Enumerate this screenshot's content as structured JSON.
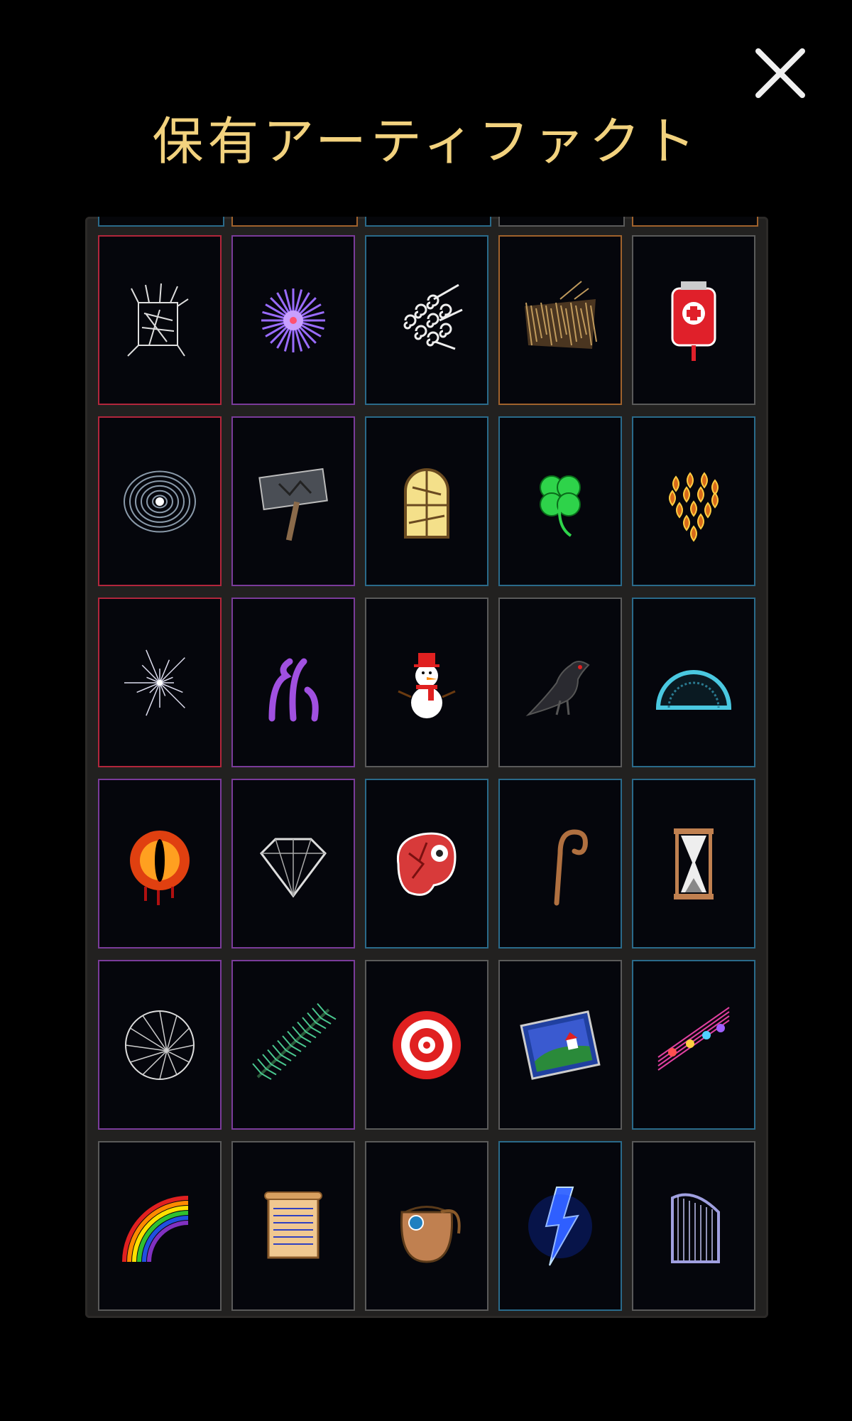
{
  "header": {
    "title": "保有アーティファクト",
    "close_icon": "close-icon"
  },
  "colors": {
    "title": "#f2d27e",
    "red": "#b2263c",
    "purple": "#7a3b9a",
    "blue": "#2a6a8a",
    "orange": "#a0622c",
    "gray": "#5a5a5a"
  },
  "top_peek_rarities": [
    "blue",
    "orange",
    "blue",
    "gray",
    "orange"
  ],
  "artifacts": [
    {
      "icon": "thorny-cage-icon",
      "rarity": "red"
    },
    {
      "icon": "purple-spiky-orb-icon",
      "rarity": "purple"
    },
    {
      "icon": "wind-swirls-icon",
      "rarity": "blue"
    },
    {
      "icon": "straw-nest-icon",
      "rarity": "orange"
    },
    {
      "icon": "blood-bag-icon",
      "rarity": "gray"
    },
    {
      "icon": "ripple-vortex-icon",
      "rarity": "red"
    },
    {
      "icon": "war-hammer-icon",
      "rarity": "purple"
    },
    {
      "icon": "stained-glass-window-icon",
      "rarity": "blue"
    },
    {
      "icon": "four-leaf-clover-icon",
      "rarity": "blue"
    },
    {
      "icon": "flame-leaf-heart-icon",
      "rarity": "blue"
    },
    {
      "icon": "shattered-star-icon",
      "rarity": "red"
    },
    {
      "icon": "purple-tentacles-icon",
      "rarity": "purple"
    },
    {
      "icon": "snowman-icon",
      "rarity": "gray"
    },
    {
      "icon": "crow-icon",
      "rarity": "gray"
    },
    {
      "icon": "cyan-dome-icon",
      "rarity": "blue"
    },
    {
      "icon": "bleeding-eye-icon",
      "rarity": "purple"
    },
    {
      "icon": "diamond-icon",
      "rarity": "purple"
    },
    {
      "icon": "raw-steak-icon",
      "rarity": "blue"
    },
    {
      "icon": "shepherd-crook-icon",
      "rarity": "blue"
    },
    {
      "icon": "hourglass-icon",
      "rarity": "blue"
    },
    {
      "icon": "cracked-glass-orb-icon",
      "rarity": "purple"
    },
    {
      "icon": "pine-branch-icon",
      "rarity": "purple"
    },
    {
      "icon": "bullseye-target-icon",
      "rarity": "gray"
    },
    {
      "icon": "painting-picture-icon",
      "rarity": "gray"
    },
    {
      "icon": "music-notes-icon",
      "rarity": "blue"
    },
    {
      "icon": "rainbow-icon",
      "rarity": "gray"
    },
    {
      "icon": "ancient-scroll-icon",
      "rarity": "gray"
    },
    {
      "icon": "leather-pouch-icon",
      "rarity": "gray"
    },
    {
      "icon": "blue-lightning-icon",
      "rarity": "blue"
    },
    {
      "icon": "harp-icon",
      "rarity": "gray"
    }
  ]
}
